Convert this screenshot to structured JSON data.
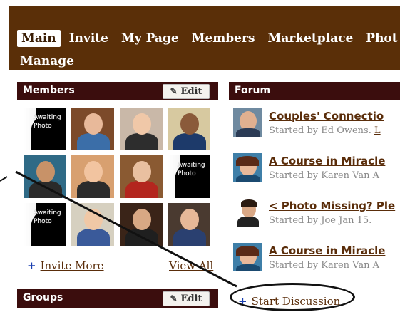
{
  "nav": {
    "items": [
      "Main",
      "Invite",
      "My Page",
      "Members",
      "Marketplace",
      "Phot"
    ],
    "second_row": [
      "Manage"
    ],
    "active": "Main"
  },
  "members": {
    "title": "Members",
    "edit_label": "Edit",
    "awaiting_text": "Awaiting Photo",
    "photos": [
      {
        "type": "awaiting"
      },
      {
        "type": "photo",
        "skin": "#e8b99a",
        "bg": "#7c4a2a",
        "shirt": "#3b6ea8"
      },
      {
        "type": "photo",
        "skin": "#f0c8a8",
        "bg": "#c9b8a8",
        "shirt": "#2d2d2d"
      },
      {
        "type": "photo",
        "skin": "#8a5a3a",
        "bg": "#d7c9a0",
        "shirt": "#1d3a6a"
      },
      {
        "type": "photo",
        "skin": "#c89268",
        "bg": "#2f6a86",
        "shirt": "#2a2a2a"
      },
      {
        "type": "photo",
        "skin": "#f2c4a0",
        "bg": "#d8a070",
        "shirt": "#2b2b2b"
      },
      {
        "type": "photo",
        "skin": "#e9c0a0",
        "bg": "#8a5a32",
        "shirt": "#b3261e"
      },
      {
        "type": "awaiting"
      },
      {
        "type": "awaiting"
      },
      {
        "type": "photo",
        "skin": "#f0c8a6",
        "bg": "#d6d0c0",
        "shirt": "#3a5a9a"
      },
      {
        "type": "photo",
        "skin": "#d8a884",
        "bg": "#3a2418",
        "shirt": "#1f1f1f"
      },
      {
        "type": "photo",
        "skin": "#e6b898",
        "bg": "#4a3a30",
        "shirt": "#2a4070"
      }
    ],
    "invite_more": "Invite More",
    "view_all": "View All"
  },
  "groups": {
    "title": "Groups",
    "edit_label": "Edit"
  },
  "forum": {
    "title": "Forum",
    "items": [
      {
        "title": "Couples' Connectio",
        "meta": "Started by Ed Owens. ",
        "meta_link": "L"
      },
      {
        "title": "A Course in Miracle",
        "meta": "Started by Karen Van A",
        "meta_link": ""
      },
      {
        "title": "< Photo Missing? Ple",
        "meta": "Started by Joe Jan 15.",
        "meta_link": ""
      },
      {
        "title": "A Course in Miracle",
        "meta": "Started by Karen Van A",
        "meta_link": ""
      }
    ],
    "start_discussion": "Start Discussion"
  },
  "colors": {
    "nav_bg": "#5a2f08",
    "header_bg": "#3b0d0d",
    "link": "#5a2d0a",
    "plus": "#1a3fb0"
  }
}
